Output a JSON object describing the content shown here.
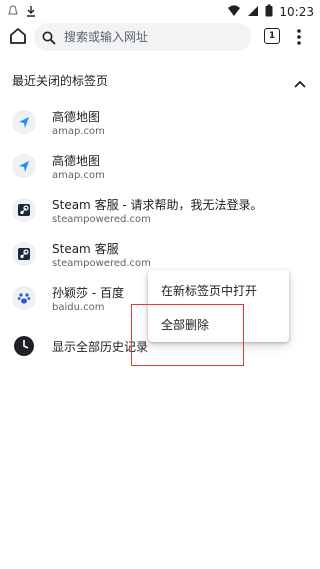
{
  "status_bar": {
    "time": "10:23"
  },
  "toolbar": {
    "omnibox_placeholder": "搜索或输入网址",
    "tab_count": "1"
  },
  "recently_closed": {
    "title": "最近关闭的标签页",
    "items": [
      {
        "title": "高德地图",
        "url": "amap.com",
        "icon": "amap-arrow-icon"
      },
      {
        "title": "高德地图",
        "url": "amap.com",
        "icon": "amap-arrow-icon"
      },
      {
        "title": "Steam 客服 - 请求帮助，我无法登录。",
        "url": "steampowered.com",
        "icon": "steam-icon"
      },
      {
        "title": "Steam 客服",
        "url": "steampowered.com",
        "icon": "steam-icon"
      },
      {
        "title": "孙颖莎 - 百度",
        "url": "baidu.com",
        "icon": "baidu-paw-icon"
      }
    ],
    "show_history": "显示全部历史记录"
  },
  "context_menu": {
    "open_in_new_tab": "在新标签页中打开",
    "delete_all": "全部删除"
  },
  "colors": {
    "amap_blue": "#2d8cf0",
    "highlight_red": "#e53935"
  }
}
